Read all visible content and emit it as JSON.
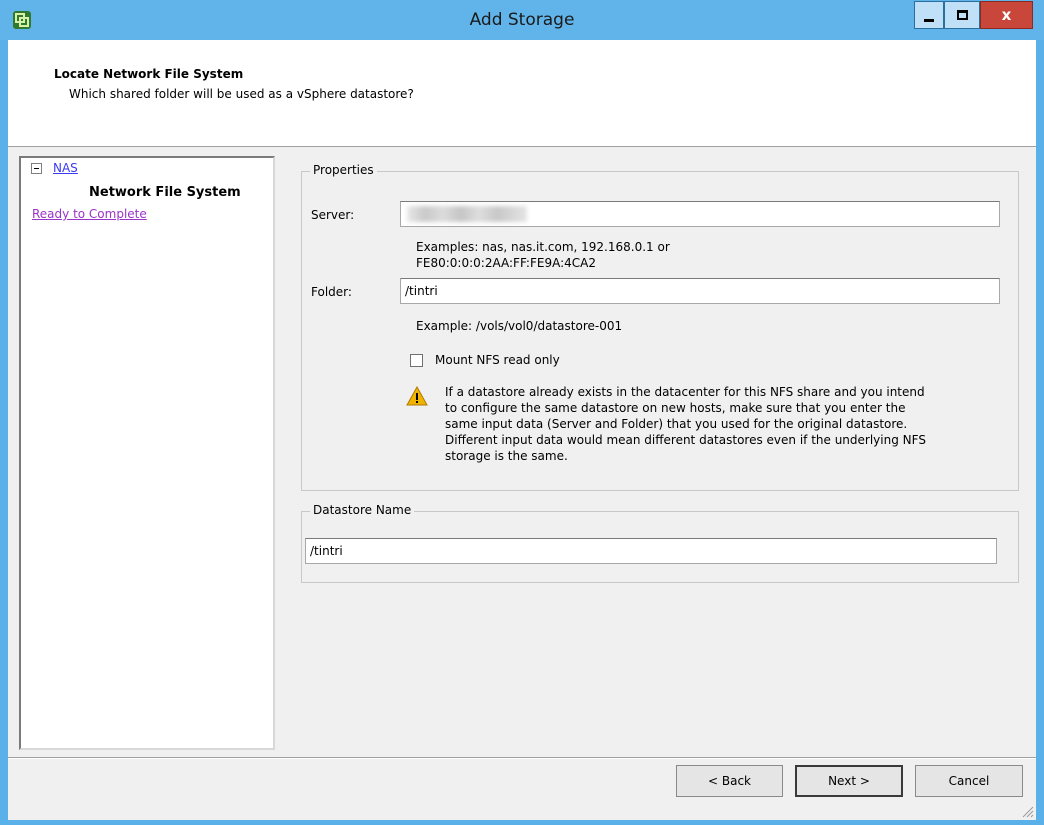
{
  "window": {
    "title": "Add Storage"
  },
  "header": {
    "title": "Locate Network File System",
    "subtitle": "Which shared folder will be used as a vSphere datastore?"
  },
  "nav": {
    "nas": "NAS",
    "current": "Network File System",
    "ready": "Ready to Complete"
  },
  "properties": {
    "legend": "Properties",
    "server_label": "Server:",
    "server_value": "",
    "server_hint_1": "Examples: nas, nas.it.com, 192.168.0.1 or",
    "server_hint_2": "FE80:0:0:0:2AA:FF:FE9A:4CA2",
    "folder_label": "Folder:",
    "folder_value": "/tintri",
    "folder_hint": "Example: /vols/vol0/datastore-001",
    "readonly_label": "Mount NFS read only",
    "readonly_checked": false,
    "warning_lines": [
      "If a datastore already exists in the datacenter for this NFS share and you intend",
      "to configure the same datastore on new hosts, make sure that you enter the",
      "same input data (Server and Folder) that you used for the original datastore.",
      "Different input data would mean different datastores even if the underlying NFS",
      "storage is the same."
    ]
  },
  "datastore": {
    "legend": "Datastore Name",
    "value": "/tintri"
  },
  "buttons": {
    "back": "< Back",
    "next": "Next >",
    "cancel": "Cancel"
  },
  "colors": {
    "titlebar": "#60b4ea",
    "close_button": "#c9473a",
    "link": "#3a3af0",
    "visited_link": "#9a33c8",
    "warning": "#f0b400"
  }
}
